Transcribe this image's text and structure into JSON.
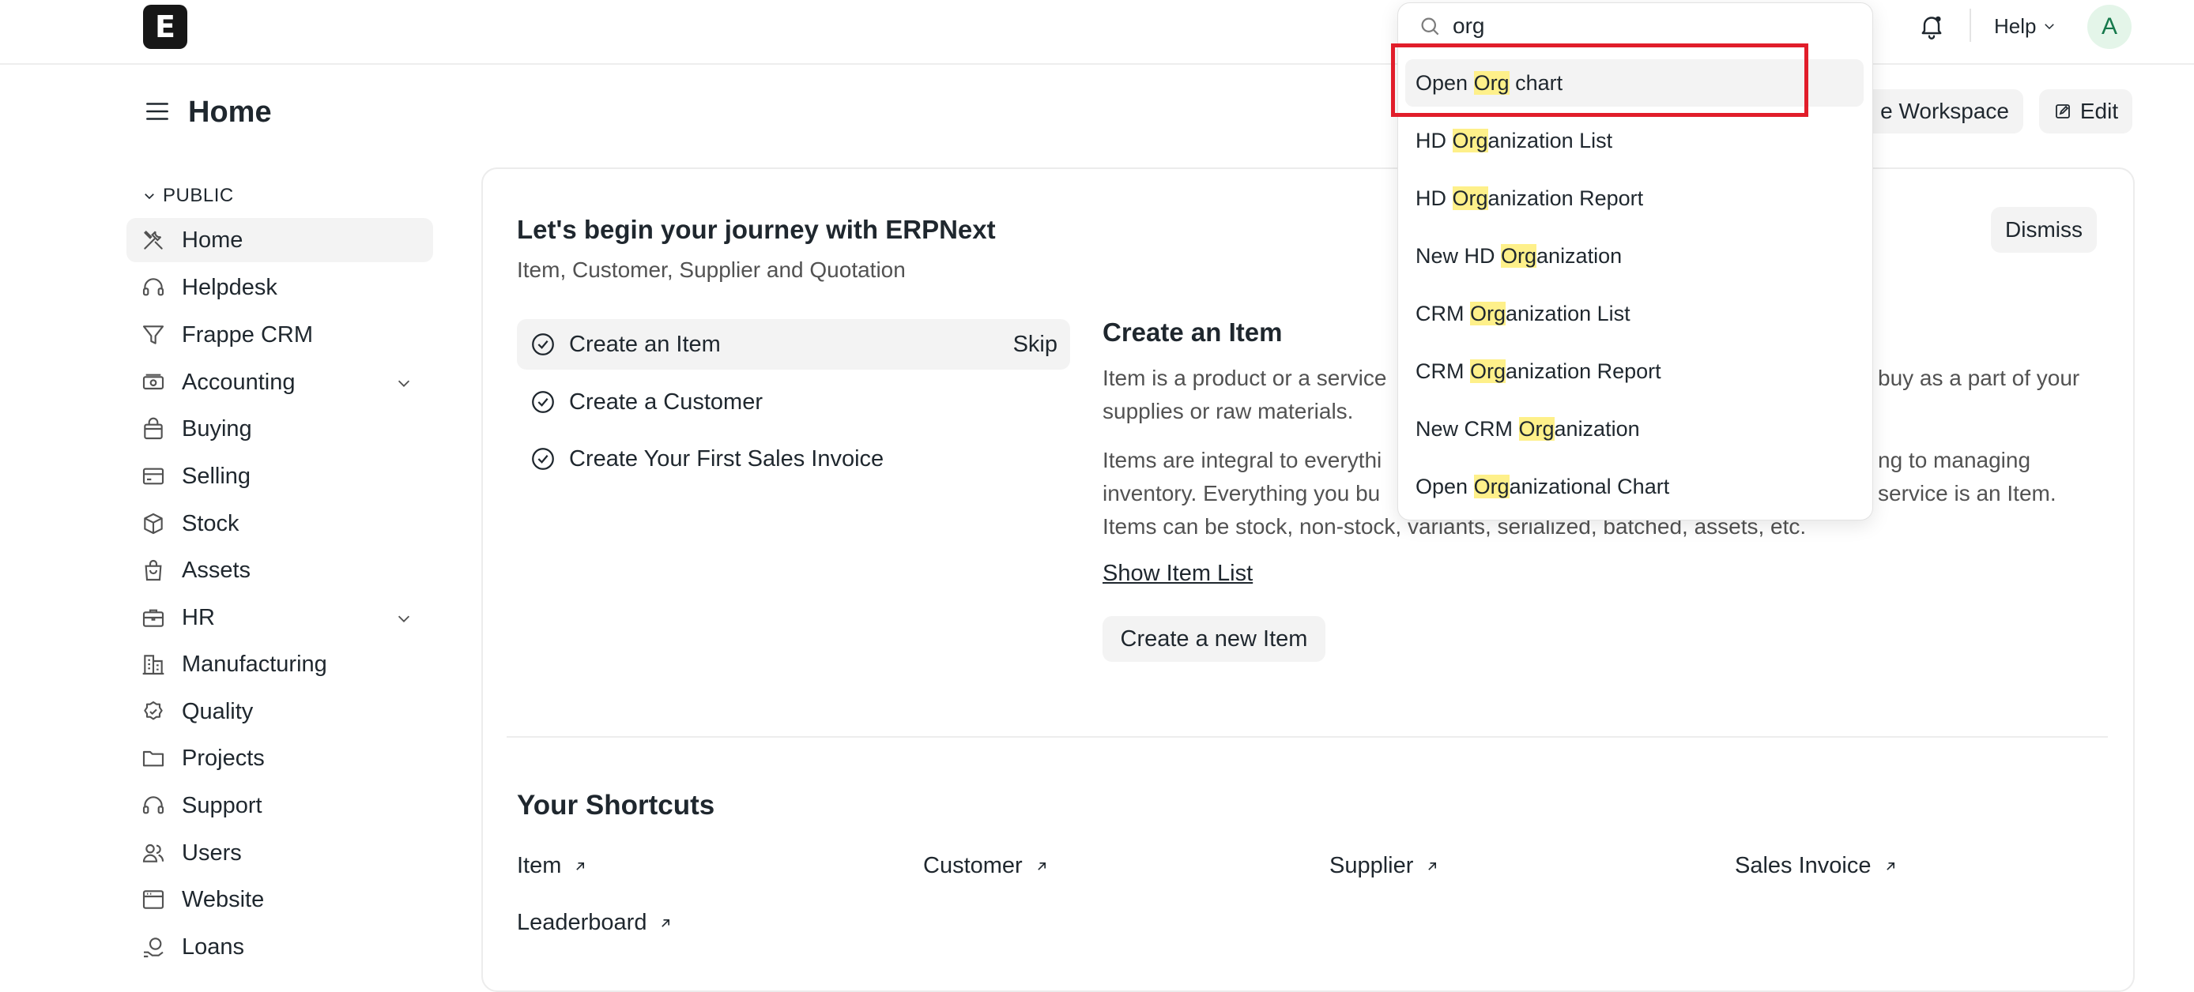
{
  "navbar": {
    "logo_letter": "E",
    "help_label": "Help",
    "avatar_initial": "A"
  },
  "page": {
    "title": "Home",
    "workspace_button": "e Workspace",
    "edit_button": "Edit"
  },
  "sidebar": {
    "section_label": "PUBLIC",
    "items": [
      {
        "label": "Home",
        "icon": "tools-icon"
      },
      {
        "label": "Helpdesk",
        "icon": "headset-icon"
      },
      {
        "label": "Frappe CRM",
        "icon": "funnel-icon"
      },
      {
        "label": "Accounting",
        "icon": "money-icon"
      },
      {
        "label": "Buying",
        "icon": "shopping-bag-icon"
      },
      {
        "label": "Selling",
        "icon": "credit-card-icon"
      },
      {
        "label": "Stock",
        "icon": "box-icon"
      },
      {
        "label": "Assets",
        "icon": "bag-icon"
      },
      {
        "label": "HR",
        "icon": "briefcase-icon"
      },
      {
        "label": "Manufacturing",
        "icon": "factory-icon"
      },
      {
        "label": "Quality",
        "icon": "badge-check-icon"
      },
      {
        "label": "Projects",
        "icon": "folder-icon"
      },
      {
        "label": "Support",
        "icon": "headset-icon"
      },
      {
        "label": "Users",
        "icon": "users-icon"
      },
      {
        "label": "Website",
        "icon": "browser-icon"
      },
      {
        "label": "Loans",
        "icon": "loan-icon"
      }
    ]
  },
  "onboarding": {
    "title": "Let's begin your journey with ERPNext",
    "subtitle": "Item, Customer, Supplier and Quotation",
    "dismiss": "Dismiss",
    "steps": [
      {
        "label": "Create an Item",
        "skip": "Skip"
      },
      {
        "label": "Create a Customer"
      },
      {
        "label": "Create Your First Sales Invoice"
      }
    ],
    "detail": {
      "title": "Create an Item",
      "para1_line1": "Item is a product or a service",
      "para1_line1_end": "buy as a part of your",
      "para1_line2": "supplies or raw materials.",
      "para2_line1": "Items are integral to everythi",
      "para2_line1_end": "ng to managing",
      "para2_line2": "inventory. Everything you bu",
      "para2_line2_end": "service is an Item.",
      "para2_line3": "Items can be stock, non-stock, variants, serialized, batched, assets, etc.",
      "show_list": "Show Item List",
      "create_button": "Create a new Item"
    }
  },
  "shortcuts": {
    "title": "Your Shortcuts",
    "items": [
      "Item",
      "Customer",
      "Supplier",
      "Sales Invoice",
      "Leaderboard"
    ]
  },
  "search": {
    "value": "org",
    "results": [
      {
        "pre": "Open ",
        "hl": "Org",
        "post": " chart"
      },
      {
        "pre": "HD ",
        "hl": "Org",
        "post": "anization List"
      },
      {
        "pre": "HD ",
        "hl": "Org",
        "post": "anization Report"
      },
      {
        "pre": "New HD ",
        "hl": "Org",
        "post": "anization"
      },
      {
        "pre": "CRM ",
        "hl": "Org",
        "post": "anization List"
      },
      {
        "pre": "CRM ",
        "hl": "Org",
        "post": "anization Report"
      },
      {
        "pre": "New CRM ",
        "hl": "Org",
        "post": "anization"
      },
      {
        "pre": "Open ",
        "hl": "Org",
        "post": "anizational Chart"
      }
    ]
  },
  "colors": {
    "highlight": "#fef08a",
    "annotation_box": "#e11d2a",
    "active_bg": "#f3f3f3"
  }
}
